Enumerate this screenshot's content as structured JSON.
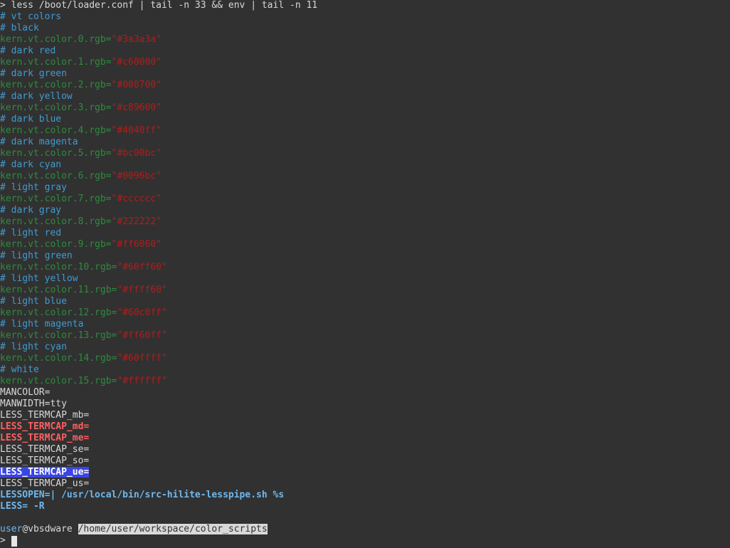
{
  "terminal": {
    "command_prompt": "> ",
    "command": "less /boot/loader.conf | tail -n 33 && env | tail -n 11",
    "config_lines": [
      {
        "comment": "# vt colors"
      },
      {
        "comment": "# black"
      },
      {
        "key": "kern.vt.color.0.rgb=",
        "value": "\"#3a3a3a\""
      },
      {
        "comment": "# dark red"
      },
      {
        "key": "kern.vt.color.1.rgb=",
        "value": "\"#c60000\""
      },
      {
        "comment": "# dark green"
      },
      {
        "key": "kern.vt.color.2.rgb=",
        "value": "\"#008700\""
      },
      {
        "comment": "# dark yellow"
      },
      {
        "key": "kern.vt.color.3.rgb=",
        "value": "\"#c89600\""
      },
      {
        "comment": "# dark blue"
      },
      {
        "key": "kern.vt.color.4.rgb=",
        "value": "\"#4040ff\""
      },
      {
        "comment": "# dark magenta"
      },
      {
        "key": "kern.vt.color.5.rgb=",
        "value": "\"#bc00bc\""
      },
      {
        "comment": "# dark cyan"
      },
      {
        "key": "kern.vt.color.6.rgb=",
        "value": "\"#0096bc\""
      },
      {
        "comment": "# light gray"
      },
      {
        "key": "kern.vt.color.7.rgb=",
        "value": "\"#cccccc\""
      },
      {
        "comment": "# dark gray"
      },
      {
        "key": "kern.vt.color.8.rgb=",
        "value": "\"#222222\""
      },
      {
        "comment": "# light red"
      },
      {
        "key": "kern.vt.color.9.rgb=",
        "value": "\"#ff6060\""
      },
      {
        "comment": "# light green"
      },
      {
        "key": "kern.vt.color.10.rgb=",
        "value": "\"#60ff60\""
      },
      {
        "comment": "# light yellow"
      },
      {
        "key": "kern.vt.color.11.rgb=",
        "value": "\"#ffff60\""
      },
      {
        "comment": "# light blue"
      },
      {
        "key": "kern.vt.color.12.rgb=",
        "value": "\"#60c0ff\""
      },
      {
        "comment": "# light magenta"
      },
      {
        "key": "kern.vt.color.13.rgb=",
        "value": "\"#ff60ff\""
      },
      {
        "comment": "# light cyan"
      },
      {
        "key": "kern.vt.color.14.rgb=",
        "value": "\"#60ffff\""
      },
      {
        "comment": "# white"
      },
      {
        "key": "kern.vt.color.15.rgb=",
        "value": "\"#ffffff\""
      }
    ],
    "env_lines": [
      {
        "text": "MANCOLOR=",
        "style": "plain"
      },
      {
        "text": "MANWIDTH=tty",
        "style": "plain"
      },
      {
        "text": "LESS_TERMCAP_mb=",
        "style": "plain"
      },
      {
        "text": "LESS_TERMCAP_md=",
        "style": "red-bold"
      },
      {
        "text": "LESS_TERMCAP_me=",
        "style": "red-bold"
      },
      {
        "text": "LESS_TERMCAP_se=",
        "style": "plain"
      },
      {
        "text": "LESS_TERMCAP_so=",
        "style": "plain"
      },
      {
        "text": "LESS_TERMCAP_ue=",
        "style": "hl-blue"
      },
      {
        "text": "LESS_TERMCAP_us=",
        "style": "plain"
      },
      {
        "text": "LESSOPEN=| /usr/local/bin/src-hilite-lesspipe.sh %s",
        "style": "lessopen"
      },
      {
        "text": "LESS= -R",
        "style": "lessopen"
      }
    ],
    "prompt": {
      "user": "user",
      "host": "@vbsdware",
      "cwd": "/home/user/workspace/color_scripts",
      "input_prompt": "> "
    }
  },
  "colors": {
    "background": "#313131",
    "comment": "#3f9bd0",
    "key": "#2e8b3e",
    "string": "#b01d1d",
    "highlight": "#3a45e4"
  }
}
